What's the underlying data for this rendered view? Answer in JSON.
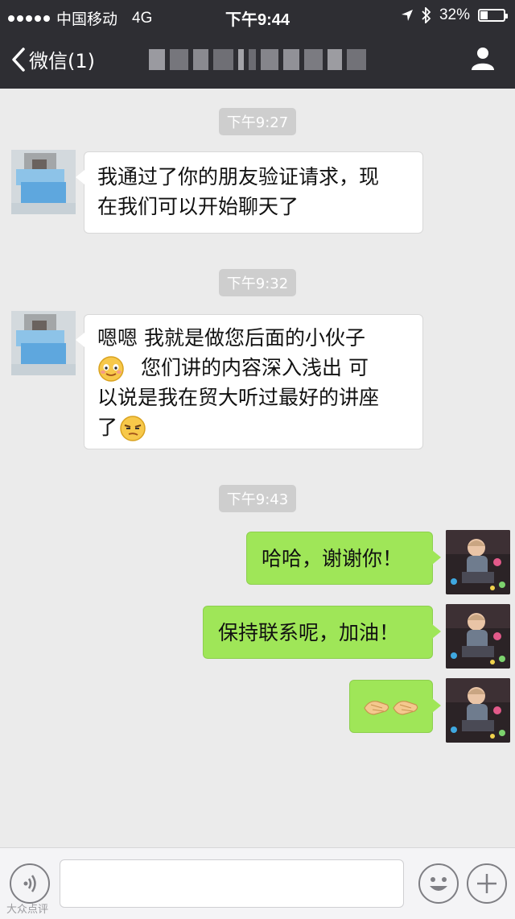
{
  "status_bar": {
    "carrier": "中国移动",
    "network": "4G",
    "time": "下午9:44",
    "battery": "32%",
    "battery_level": 0.32
  },
  "nav": {
    "back_label": "微信(1)",
    "title_obscured": true
  },
  "messages": [
    {
      "type": "timestamp",
      "text": "下午9:27"
    },
    {
      "type": "incoming",
      "lines": [
        "我通过了你的朋友验证请求，现",
        "在我们可以开始聊天了"
      ]
    },
    {
      "type": "timestamp",
      "text": "下午9:32"
    },
    {
      "type": "incoming",
      "line1": "嗯嗯  我就是做您后面的小伙子",
      "line2": "您们讲的内容深入浅出   可",
      "line3": "以说是我在贸大听过最好的讲座",
      "line4": "了"
    },
    {
      "type": "timestamp",
      "text": "下午9:43"
    },
    {
      "type": "outgoing",
      "text": "哈哈，谢谢你！"
    },
    {
      "type": "outgoing",
      "text": "保持联系呢，加油！"
    },
    {
      "type": "outgoing",
      "text": "",
      "emoji": "handshake-emoji"
    }
  ],
  "icons": {
    "back": "chevron-left-icon",
    "contact": "person-icon",
    "voice": "voice-icon",
    "emoji": "smiley-icon",
    "more": "plus-icon"
  },
  "watermark": "大众点评",
  "colors": {
    "header_bg": "#2e2e33",
    "chat_bg": "#ebebeb",
    "outgoing_bubble": "#9fe658",
    "incoming_bubble": "#ffffff"
  }
}
